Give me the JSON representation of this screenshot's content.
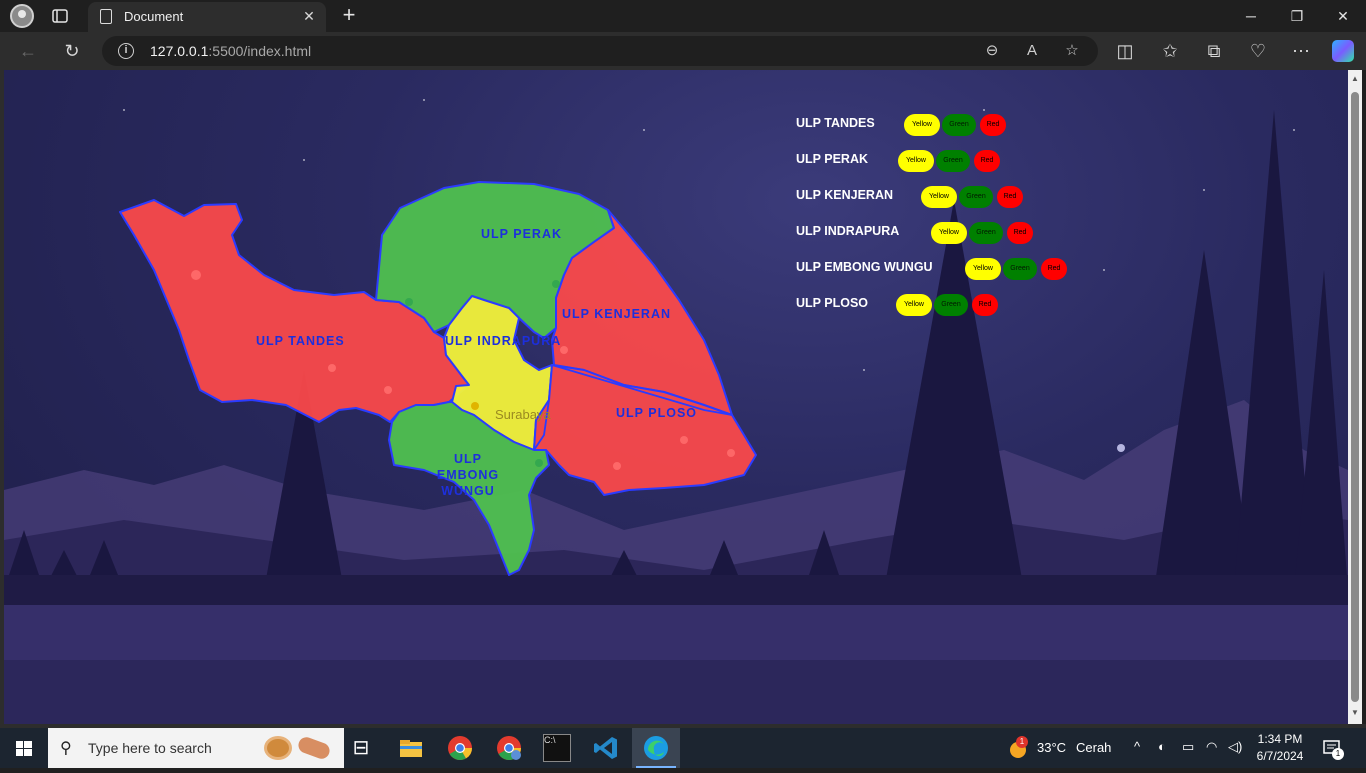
{
  "browser": {
    "tab_title": "Document",
    "url_host": "127.0.0.1",
    "url_path": ":5500/index.html"
  },
  "map": {
    "regions": {
      "tandes": "ULP TANDES",
      "perak": "ULP PERAK",
      "indrapura": "ULP INDRAPURA",
      "kenjeran": "ULP KENJERAN",
      "ploso": "ULP PLOSO",
      "embong_wungu_1": "ULP",
      "embong_wungu_2": "EMBONG",
      "embong_wungu_3": "WUNGU"
    },
    "city_label": "Surabaya",
    "colors": {
      "red": "#ff4a4a",
      "green": "#4fc04f",
      "yellow": "#f2f23a",
      "border": "#2b3bff"
    }
  },
  "legend": {
    "rows": [
      {
        "name": "ULP TANDES",
        "yellow": "Yellow",
        "green": "Green",
        "red": "Red"
      },
      {
        "name": "ULP PERAK",
        "yellow": "Yellow",
        "green": "Green",
        "red": "Red"
      },
      {
        "name": "ULP KENJERAN",
        "yellow": "Yellow",
        "green": "Green",
        "red": "Red"
      },
      {
        "name": "ULP INDRAPURA",
        "yellow": "Yellow",
        "green": "Green",
        "red": "Red"
      },
      {
        "name": "ULP EMBONG WUNGU",
        "yellow": "Yellow",
        "green": "Green",
        "red": "Red"
      },
      {
        "name": "ULP PLOSO",
        "yellow": "Yellow",
        "green": "Green",
        "red": "Red"
      }
    ]
  },
  "taskbar": {
    "search_placeholder": "Type here to search",
    "weather_temp": "33°C",
    "weather_text": "Cerah",
    "time": "1:34 PM",
    "date": "6/7/2024",
    "notif_count": "1",
    "weather_badge": "1"
  }
}
